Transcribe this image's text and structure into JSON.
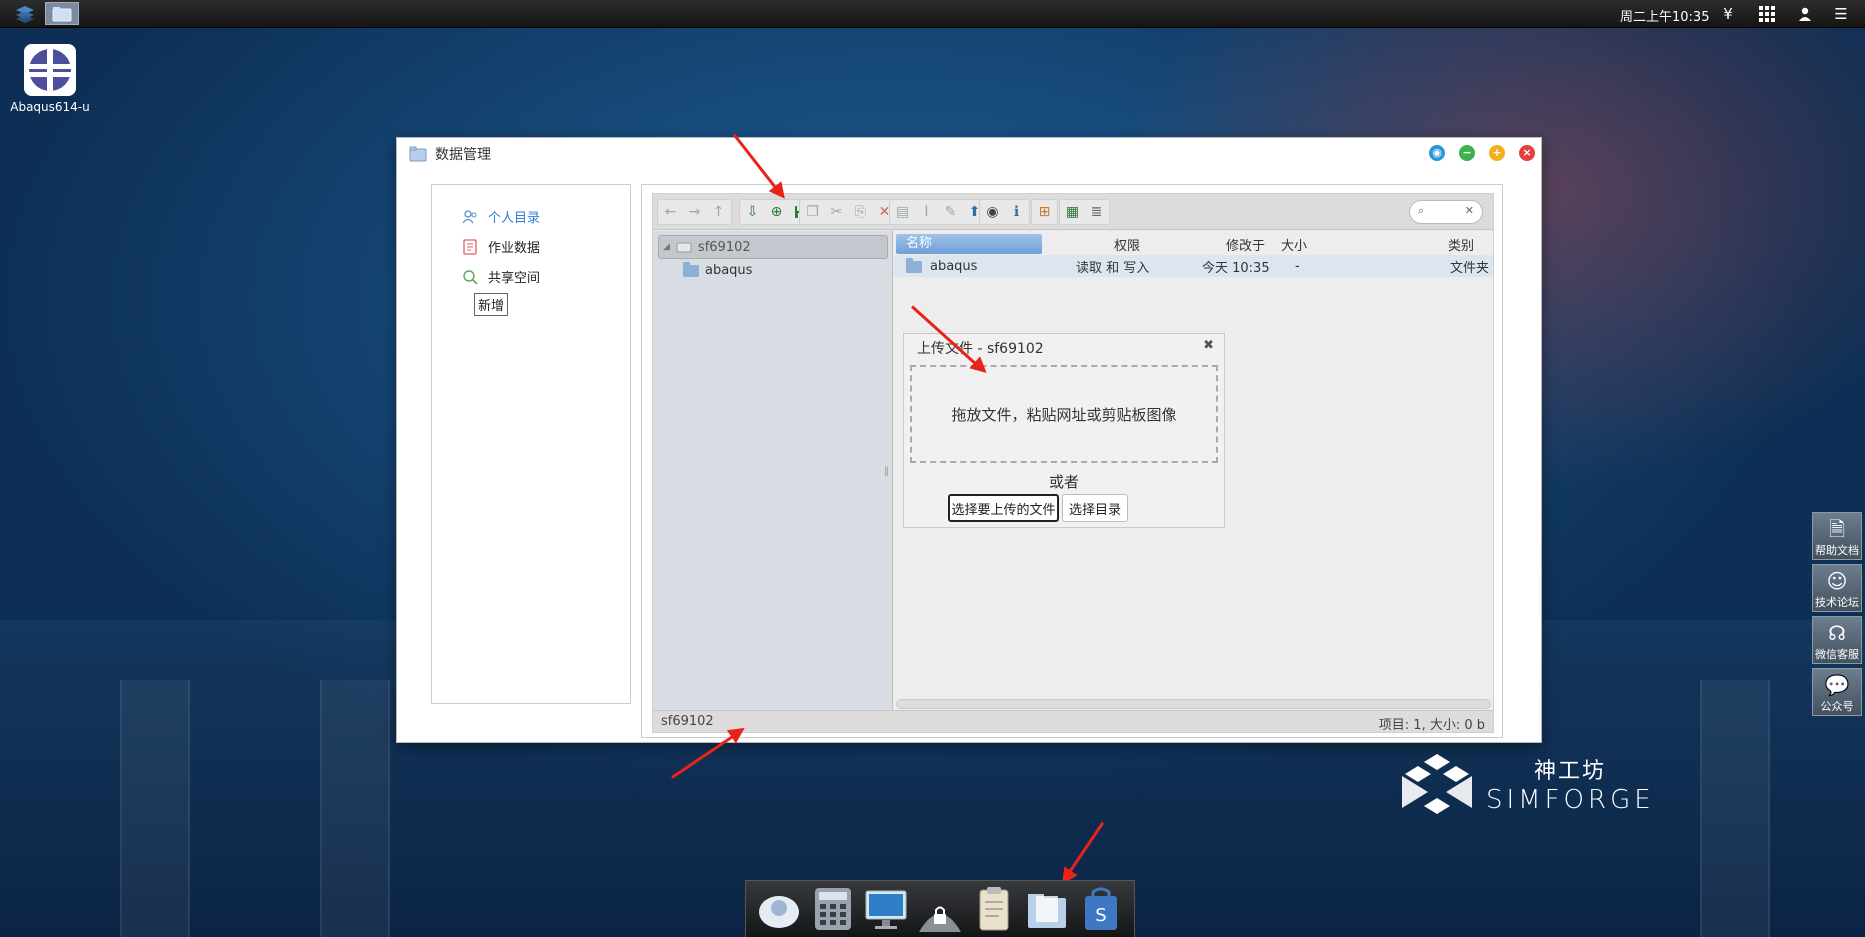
{
  "topbar": {
    "clock": "周二上午10:35"
  },
  "desktop": {
    "icon_label": "Abaqus614-u"
  },
  "window": {
    "title": "数据管理"
  },
  "nav": {
    "items": [
      {
        "label": "个人目录",
        "active": true
      },
      {
        "label": "作业数据",
        "active": false
      },
      {
        "label": "共享空间",
        "active": false
      }
    ],
    "add_label": "新增"
  },
  "tree": {
    "root": "sf69102",
    "child": "abaqus"
  },
  "files": {
    "headers": {
      "name": "名称",
      "perm": "权限",
      "modified": "修改于",
      "size": "大小",
      "kind": "类别"
    },
    "rows": [
      {
        "name": "abaqus",
        "perm": "读取 和 写入",
        "modified": "今天 10:35",
        "size": "-",
        "kind": "文件夹"
      }
    ]
  },
  "upload": {
    "title": "上传文件 - sf69102",
    "drop_text": "拖放文件，粘贴网址或剪贴板图像",
    "or_text": "或者",
    "choose_files": "选择要上传的文件",
    "choose_dir": "选择目录"
  },
  "statusbar": {
    "path": "sf69102",
    "summary": "项目: 1, 大小: 0 b"
  },
  "side_panel": {
    "items": [
      {
        "label": "帮助文档",
        "icon": "document-icon"
      },
      {
        "label": "技术论坛",
        "icon": "forum-icon"
      },
      {
        "label": "微信客服",
        "icon": "headset-icon"
      },
      {
        "label": "公众号",
        "icon": "wechat-icon"
      }
    ]
  },
  "brand": {
    "cn": "神工坊",
    "en": "SIMFORGE"
  },
  "colors": {
    "accent": "#2f7fd8",
    "annotation": "#e8231a"
  }
}
